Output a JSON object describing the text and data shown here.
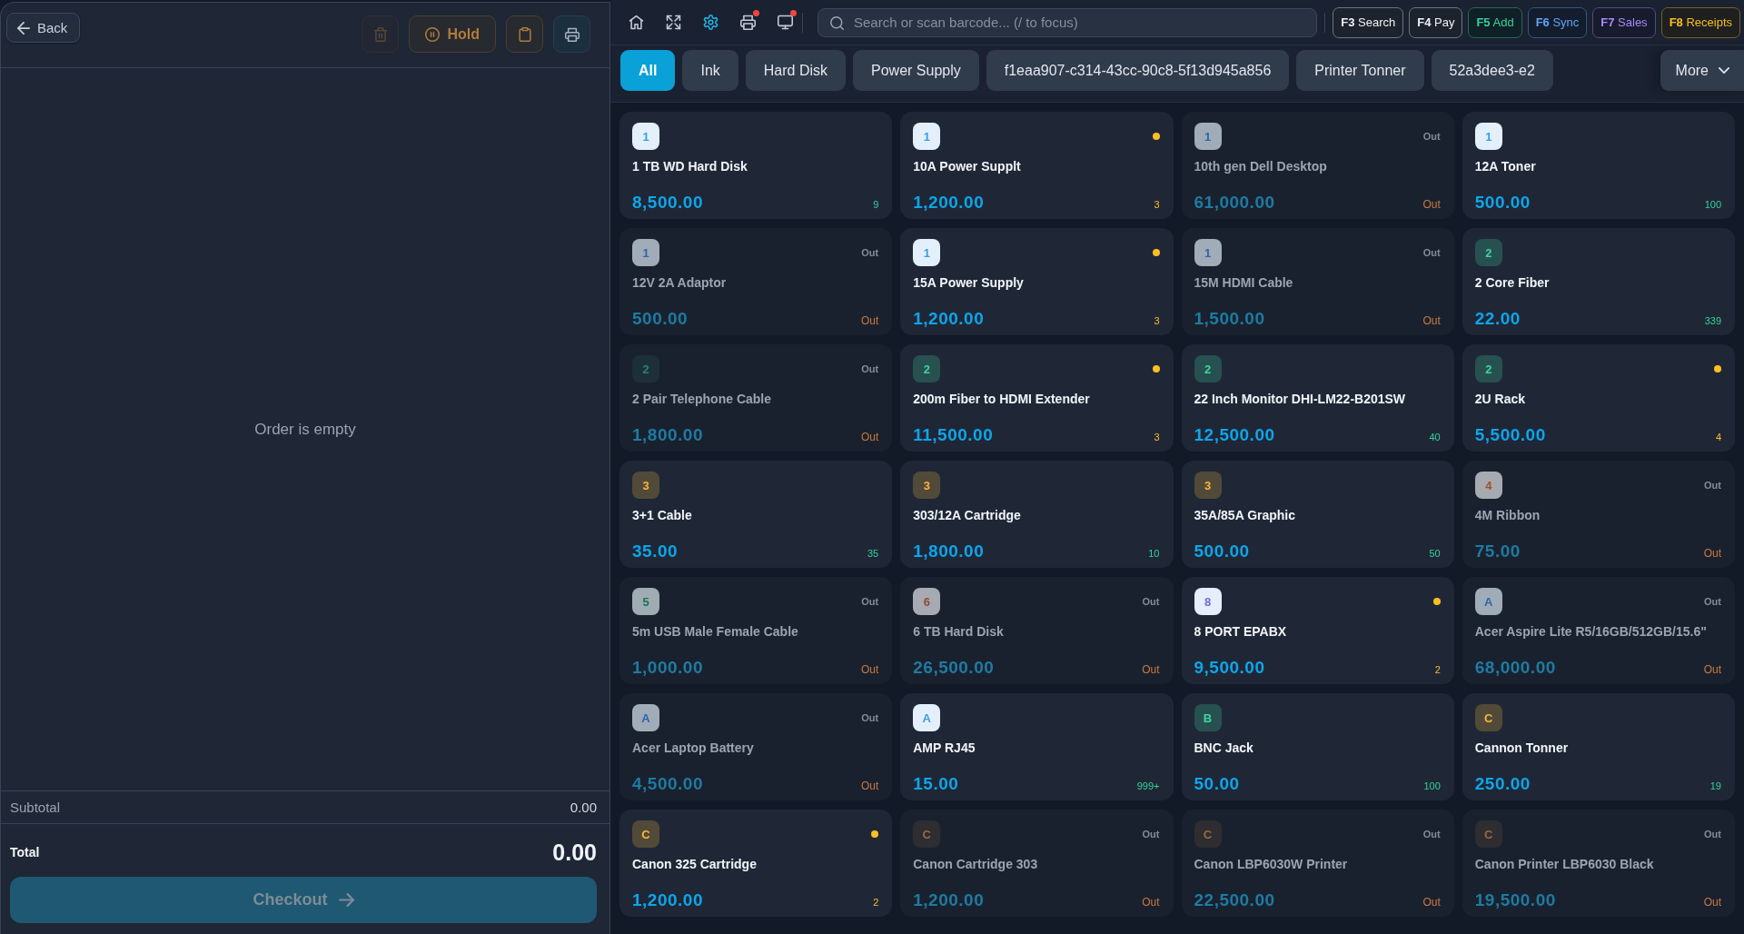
{
  "order_panel": {
    "back": {
      "label": "Back"
    },
    "actions": [
      {
        "kind": "delete",
        "disabled": true
      },
      {
        "kind": "hold",
        "label": "Hold",
        "disabled": false
      },
      {
        "kind": "clipboard",
        "disabled": false
      },
      {
        "kind": "print",
        "disabled": false
      }
    ],
    "empty_message": "Order is empty",
    "subtotal": {
      "label": "Subtotal",
      "value": "0.00"
    },
    "total": {
      "label": "Total",
      "value": "0.00"
    },
    "checkout": {
      "label": "Checkout",
      "disabled": true
    }
  },
  "toolbar": {
    "icons": [
      {
        "kind": "home",
        "active": false,
        "alert": false
      },
      {
        "kind": "expand",
        "active": false,
        "alert": false
      },
      {
        "kind": "settings",
        "active": true,
        "alert": false
      },
      {
        "kind": "printer",
        "active": false,
        "alert": true
      },
      {
        "kind": "monitor",
        "active": false,
        "alert": true
      }
    ],
    "search": {
      "placeholder": "Search or scan barcode... (/ to focus)"
    },
    "shortcuts": [
      {
        "key": "F3",
        "label": "Search",
        "color": "#eef2f6"
      },
      {
        "key": "F4",
        "label": "Pay",
        "color": "#eef2f6"
      },
      {
        "key": "F5",
        "label": "Add",
        "color": "#34d399"
      },
      {
        "key": "F6",
        "label": "Sync",
        "color": "#60a5fa"
      },
      {
        "key": "F7",
        "label": "Sales",
        "color": "#a78bfa"
      },
      {
        "key": "F8",
        "label": "Receipts",
        "color": "#fbbf24"
      }
    ]
  },
  "categories": [
    {
      "label": "All",
      "selected": true
    },
    {
      "label": "Ink",
      "selected": false
    },
    {
      "label": "Hard Disk",
      "selected": false
    },
    {
      "label": "Power Supply",
      "selected": false
    },
    {
      "label": "f1eaa907-c314-43cc-90c8-5f13d945a856",
      "selected": false
    },
    {
      "label": "Printer Tonner",
      "selected": false
    },
    {
      "label": "52a3dee3-e2",
      "selected": false
    }
  ],
  "more_button": {
    "label": "More"
  },
  "products": [
    {
      "badge": {
        "text": "1",
        "color": "#3b9de0",
        "kind": "light"
      },
      "name": "1 TB WD Hard Disk",
      "price": "8,500.00",
      "stock": "9",
      "kind": "in_stock"
    },
    {
      "badge": {
        "text": "1",
        "color": "#3b9de0",
        "kind": "light"
      },
      "name": "10A Power Supplt",
      "price": "1,200.00",
      "stock": "3",
      "kind": "low_stock"
    },
    {
      "badge": {
        "text": "1",
        "color": "#2d66a8",
        "kind": "light"
      },
      "name": "10th gen Dell Desktop",
      "price": "61,000.00",
      "stock": "Out",
      "kind": "out_of_stock",
      "tag": "Out"
    },
    {
      "badge": {
        "text": "1",
        "color": "#3b9de0",
        "kind": "light"
      },
      "name": "12A Toner",
      "price": "500.00",
      "stock": "100",
      "kind": "in_stock"
    },
    {
      "badge": {
        "text": "1",
        "color": "#2d66a8",
        "kind": "light"
      },
      "name": "12V 2A Adaptor",
      "price": "500.00",
      "stock": "Out",
      "kind": "out_of_stock",
      "tag": "Out"
    },
    {
      "badge": {
        "text": "1",
        "color": "#3b9de0",
        "kind": "light"
      },
      "name": "15A Power Supply",
      "price": "1,200.00",
      "stock": "3",
      "kind": "low_stock"
    },
    {
      "badge": {
        "text": "1",
        "color": "#2d66a8",
        "kind": "light"
      },
      "name": "15M HDMI Cable",
      "price": "1,500.00",
      "stock": "Out",
      "kind": "out_of_stock",
      "tag": "Out"
    },
    {
      "badge": {
        "text": "2",
        "color": "#3fd4a0",
        "kind": "dark"
      },
      "name": "2 Core Fiber",
      "price": "22.00",
      "stock": "339",
      "kind": "in_stock"
    },
    {
      "badge": {
        "text": "2",
        "color": "#2c8173",
        "kind": "dark"
      },
      "name": "2 Pair Telephone Cable",
      "price": "1,800.00",
      "stock": "Out",
      "kind": "out_of_stock",
      "tag": "Out"
    },
    {
      "badge": {
        "text": "2",
        "color": "#3fd4a0",
        "kind": "dark"
      },
      "name": "200m Fiber to HDMI Extender",
      "price": "11,500.00",
      "stock": "3",
      "kind": "low_stock"
    },
    {
      "badge": {
        "text": "2",
        "color": "#3fd4a0",
        "kind": "dark"
      },
      "name": "22 Inch Monitor DHI-LM22-B201SW",
      "price": "12,500.00",
      "stock": "40",
      "kind": "in_stock"
    },
    {
      "badge": {
        "text": "2",
        "color": "#3fd4a0",
        "kind": "dark"
      },
      "name": "2U Rack",
      "price": "5,500.00",
      "stock": "4",
      "kind": "low_stock"
    },
    {
      "badge": {
        "text": "3",
        "color": "#f5b73b",
        "kind": "dark"
      },
      "name": "3+1 Cable",
      "price": "35.00",
      "stock": "35",
      "kind": "in_stock"
    },
    {
      "badge": {
        "text": "3",
        "color": "#f5b73b",
        "kind": "dark"
      },
      "name": "303/12A Cartridge",
      "price": "1,800.00",
      "stock": "10",
      "kind": "in_stock"
    },
    {
      "badge": {
        "text": "3",
        "color": "#f5b73b",
        "kind": "dark"
      },
      "name": "35A/85A Graphic",
      "price": "500.00",
      "stock": "50",
      "kind": "in_stock"
    },
    {
      "badge": {
        "text": "4",
        "color": "#a4521f",
        "kind": "light"
      },
      "name": "4M Ribbon",
      "price": "75.00",
      "stock": "Out",
      "kind": "out_of_stock",
      "tag": "Out"
    },
    {
      "badge": {
        "text": "5",
        "color": "#17734f",
        "kind": "light"
      },
      "name": "5m USB Male Female Cable",
      "price": "1,000.00",
      "stock": "Out",
      "kind": "out_of_stock",
      "tag": "Out"
    },
    {
      "badge": {
        "text": "6",
        "color": "#8f4a2e",
        "kind": "light"
      },
      "name": "6 TB Hard Disk",
      "price": "26,500.00",
      "stock": "Out",
      "kind": "out_of_stock",
      "tag": "Out"
    },
    {
      "badge": {
        "text": "8",
        "color": "#6e6ad8",
        "kind": "light"
      },
      "name": "8 PORT EPABX",
      "price": "9,500.00",
      "stock": "2",
      "kind": "low_stock"
    },
    {
      "badge": {
        "text": "A",
        "color": "#2d66a8",
        "kind": "light"
      },
      "name": "Acer Aspire Lite R5/16GB/512GB/15.6\"",
      "price": "68,000.00",
      "stock": "Out",
      "kind": "out_of_stock",
      "tag": "Out"
    },
    {
      "badge": {
        "text": "A",
        "color": "#2d66a8",
        "kind": "light"
      },
      "name": "Acer Laptop Battery",
      "price": "4,500.00",
      "stock": "Out",
      "kind": "out_of_stock",
      "tag": "Out"
    },
    {
      "badge": {
        "text": "A",
        "color": "#3b9de0",
        "kind": "light"
      },
      "name": "AMP RJ45",
      "price": "15.00",
      "stock": "999+",
      "kind": "in_stock"
    },
    {
      "badge": {
        "text": "B",
        "color": "#3fd4a0",
        "kind": "dark"
      },
      "name": "BNC Jack",
      "price": "50.00",
      "stock": "100",
      "kind": "in_stock"
    },
    {
      "badge": {
        "text": "C",
        "color": "#f5b73b",
        "kind": "dark"
      },
      "name": "Cannon Tonner",
      "price": "250.00",
      "stock": "19",
      "kind": "in_stock"
    },
    {
      "badge": {
        "text": "C",
        "color": "#f5b73b",
        "kind": "dark"
      },
      "name": "Canon 325 Cartridge",
      "price": "1,200.00",
      "stock": "2",
      "kind": "low_stock"
    },
    {
      "badge": {
        "text": "C",
        "color": "#9a6a3e",
        "kind": "dark"
      },
      "name": "Canon Cartridge 303",
      "price": "1,200.00",
      "stock": "Out",
      "kind": "out_of_stock",
      "tag": "Out"
    },
    {
      "badge": {
        "text": "C",
        "color": "#9a6a3e",
        "kind": "dark"
      },
      "name": "Canon LBP6030W Printer",
      "price": "22,500.00",
      "stock": "Out",
      "kind": "out_of_stock",
      "tag": "Out"
    },
    {
      "badge": {
        "text": "C",
        "color": "#9a6a3e",
        "kind": "dark"
      },
      "name": "Canon Printer LBP6030 Black",
      "price": "19,500.00",
      "stock": "Out",
      "kind": "out_of_stock",
      "tag": "Out"
    }
  ]
}
